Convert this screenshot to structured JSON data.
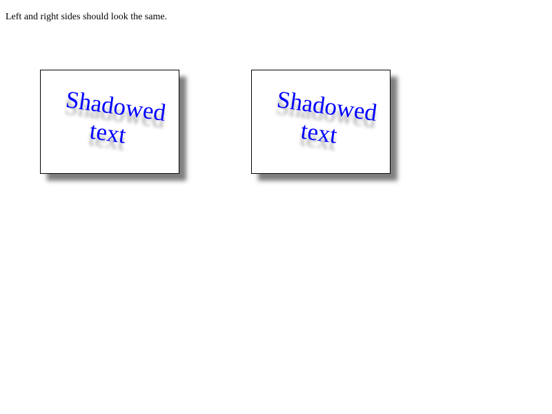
{
  "instructions": "Left and right sides should look the same.",
  "panels": [
    {
      "line1": "Shadowed",
      "line2": "text"
    },
    {
      "line1": "Shadowed",
      "line2": "text"
    }
  ],
  "colors": {
    "text": "#0000ff",
    "border": "#000000",
    "background": "#ffffff"
  }
}
